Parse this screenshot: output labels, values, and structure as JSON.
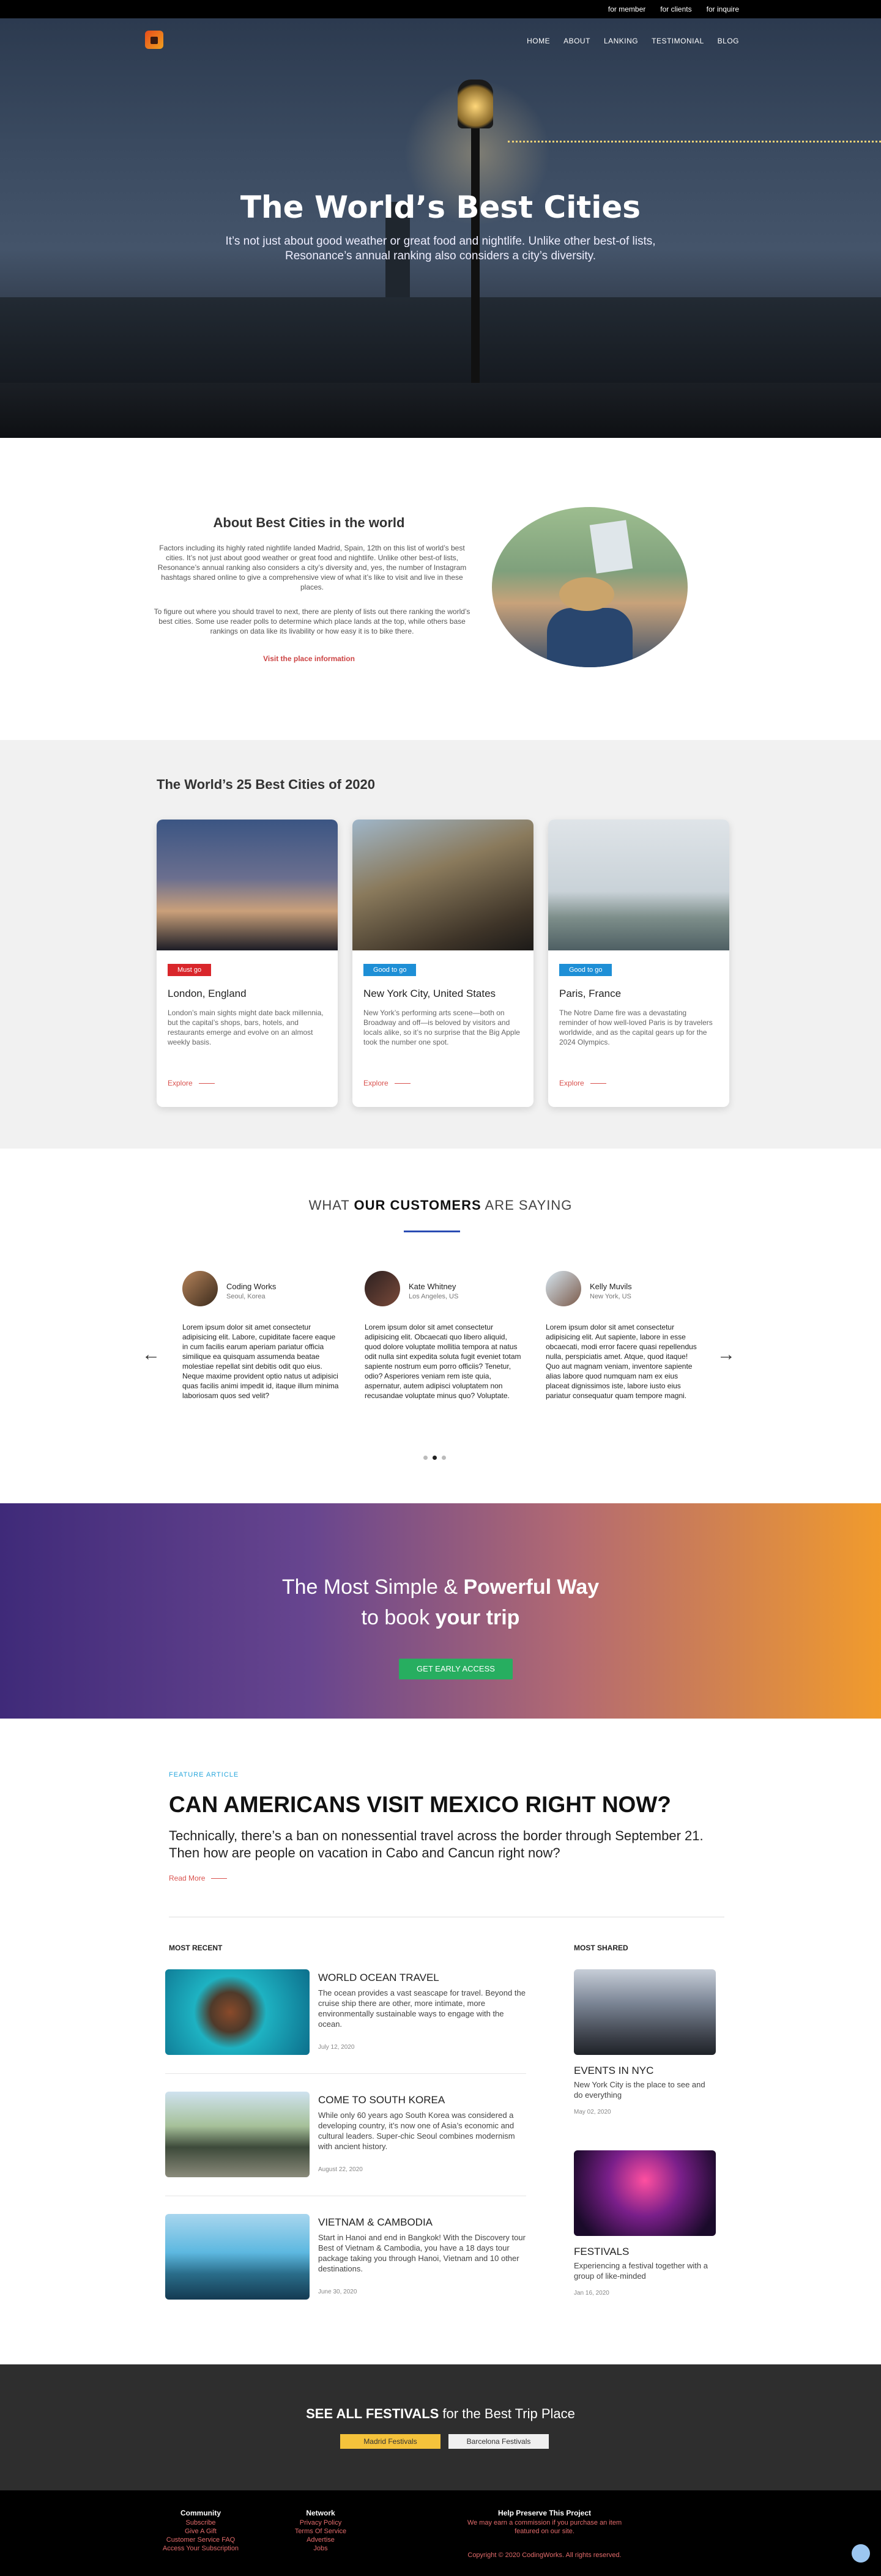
{
  "topbar": {
    "links": [
      "for member",
      "for clients",
      "for inquire"
    ]
  },
  "nav": {
    "items": [
      "HOME",
      "ABOUT",
      "LANKING",
      "TESTIMONIAL",
      "BLOG"
    ]
  },
  "hero": {
    "title": "The World’s Best Cities",
    "subtitle": "It’s not just about good weather or great food and nightlife. Unlike other best-of lists, Resonance’s annual ranking also considers a city’s diversity."
  },
  "about": {
    "title": "About Best Cities in the world",
    "p1": "Factors including its highly rated nightlife landed Madrid, Spain, 12th on this list of world’s best cities. It’s not just about good weather or great food and nightlife. Unlike other best-of lists, Resonance’s annual ranking also considers a city’s diversity and, yes, the number of Instagram hashtags shared online to give a comprehensive view of what it’s like to visit and live in these places.",
    "p2": "To figure out where you should travel to next, there are plenty of lists out there ranking the world’s best cities. Some use reader polls to determine which place lands at the top, while others base rankings on data like its livability or how easy it is to bike there.",
    "link": "Visit the place information"
  },
  "cities": {
    "title": "The World’s 25 Best Cities of 2020",
    "cards": [
      {
        "badge": "Must go",
        "badge_color": "#d9262b",
        "name": "London, England",
        "desc": "London’s main sights might date back millennia, but the capital’s shops, bars, hotels, and restaurants emerge and evolve on an almost weekly basis.",
        "link": "Explore"
      },
      {
        "badge": "Good to go",
        "badge_color": "#1e8fd6",
        "name": "New York City, United States",
        "desc": "New York’s performing arts scene—both on Broadway and off—is beloved by visitors and locals alike, so it’s no surprise that the Big Apple took the number one spot.",
        "link": "Explore"
      },
      {
        "badge": "Good to go",
        "badge_color": "#1e8fd6",
        "name": "Paris, France",
        "desc": "The Notre Dame fire was a devastating reminder of how well-loved Paris is by travelers worldwide, and as the capital gears up for the 2024 Olympics.",
        "link": "Explore"
      }
    ]
  },
  "testimonials": {
    "title_a": "WHAT ",
    "title_b": "OUR CUSTOMERS",
    "title_c": " ARE SAYING",
    "items": [
      {
        "name": "Coding Works",
        "location": "Seoul, Korea",
        "text": "Lorem ipsum dolor sit amet consectetur adipisicing elit. Labore, cupiditate facere eaque in cum facilis earum aperiam pariatur officia similique ea quisquam assumenda beatae molestiae repellat sint debitis odit quo eius. Neque maxime provident optio natus ut adipisici quas facilis animi impedit id, itaque illum minima laboriosam quos sed velit?"
      },
      {
        "name": "Kate Whitney",
        "location": "Los Angeles, US",
        "text": "Lorem ipsum dolor sit amet consectetur adipisicing elit. Obcaecati quo libero aliquid, quod dolore voluptate mollitia tempora at natus odit nulla sint expedita soluta fugit eveniet totam sapiente nostrum eum porro officiis? Tenetur, odio? Asperiores veniam rem iste quia, aspernatur, autem adipisci voluptatem non recusandae voluptate minus quo? Voluptate."
      },
      {
        "name": "Kelly Muvils",
        "location": "New York, US",
        "text": "Lorem ipsum dolor sit amet consectetur adipisicing elit. Aut sapiente, labore in esse obcaecati, modi error facere quasi repellendus nulla, perspiciatis amet. Atque, quod itaque! Quo aut magnam veniam, inventore sapiente alias labore quod numquam nam ex eius placeat dignissimos iste, labore iusto eius pariatur consequatur quam tempore magni."
      }
    ]
  },
  "cta": {
    "l1a": "The Most Simple & ",
    "l1b": "Powerful Way",
    "l2a": "to book ",
    "l2b": "your trip",
    "button": "GET EARLY ACCESS"
  },
  "feature": {
    "tag": "FEATURE ARTICLE",
    "title": "CAN AMERICANS VISIT MEXICO RIGHT NOW?",
    "lead": "Technically, there’s a ban on nonessential travel across the border through September 21. Then how are people on vacation in Cabo and Cancun right now?",
    "readmore": "Read More",
    "recent_label": "MOST RECENT",
    "shared_label": "MOST SHARED",
    "recent": [
      {
        "title": "WORLD OCEAN TRAVEL",
        "text": "The ocean provides a vast seascape for travel. Beyond the cruise ship there are other, more intimate, more environmentally sustainable ways to engage with the ocean.",
        "date": "July 12, 2020"
      },
      {
        "title": "COME TO SOUTH KOREA",
        "text": "While only 60 years ago South Korea was considered a developing country, it’s now one of Asia’s economic and cultural leaders. Super-chic Seoul combines modernism with ancient history.",
        "date": "August 22, 2020"
      },
      {
        "title": "VIETNAM & CAMBODIA",
        "text": "Start in Hanoi and end in Bangkok! With the Discovery tour Best of Vietnam & Cambodia, you have a 18 days tour package taking you through Hanoi, Vietnam and 10 other destinations.",
        "date": "June 30, 2020"
      }
    ],
    "shared": [
      {
        "title": "EVENTS IN NYC",
        "text": "New York City is the place to see and do everything",
        "date": "May 02, 2020"
      },
      {
        "title": "FESTIVALS",
        "text": "Experiencing a festival together with a group of like-minded",
        "date": "Jan 16, 2020"
      }
    ]
  },
  "festivals": {
    "title_a": "SEE ALL FESTIVALS",
    "title_b": " for the Best Trip Place",
    "btn1": "Madrid Festivals",
    "btn2": "Barcelona Festivals"
  },
  "footer": {
    "col1_title": "Community",
    "col1": [
      "Subscribe",
      "Give A Gift",
      "Customer Service FAQ",
      "Access Your Subscription"
    ],
    "col2_title": "Network",
    "col2": [
      "Privacy Policy",
      "Terms Of Service",
      "Advertise",
      "Jobs"
    ],
    "col3_title": "Help Preserve This Project",
    "col3_text": "We may earn a commission if you purchase an item featured on our site.",
    "copyright": "Copyright © 2020 CodingWorks. All rights reserved."
  }
}
